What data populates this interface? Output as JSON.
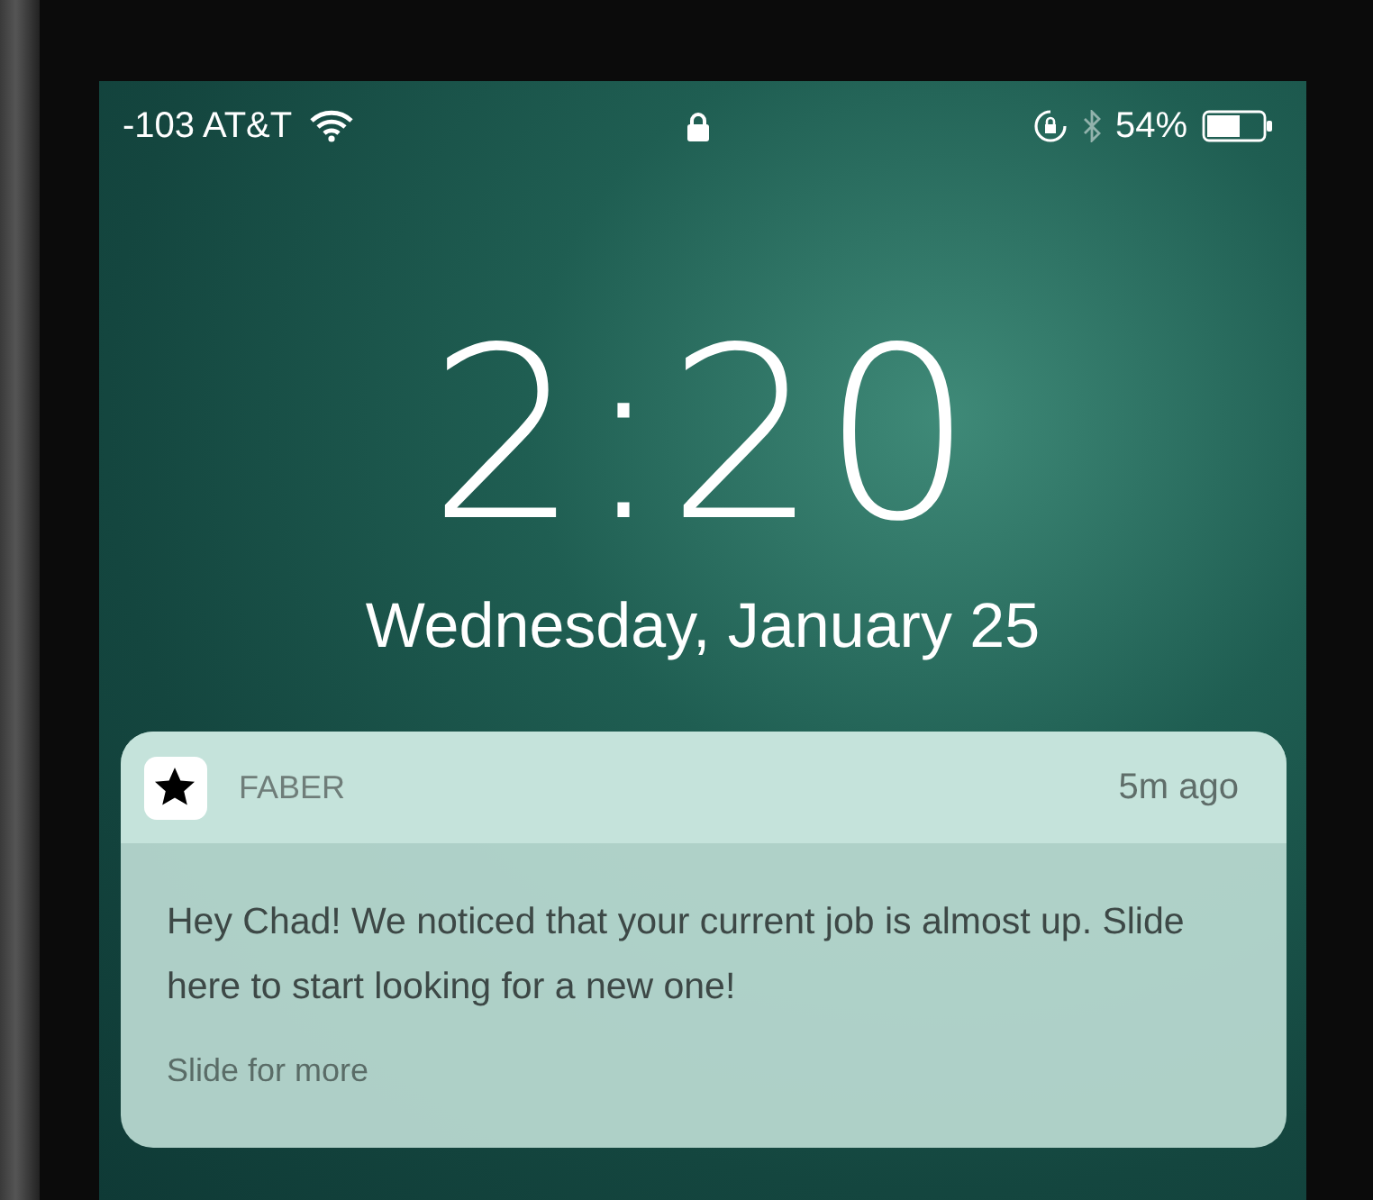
{
  "status_bar": {
    "carrier": "-103 AT&T",
    "battery": "54%"
  },
  "lock_screen": {
    "time": "2:20",
    "date": "Wednesday, January 25"
  },
  "notification": {
    "app": "FABER",
    "time": "5m ago",
    "message": "Hey Chad! We noticed that your current job is almost up. Slide here to start looking for a new one!",
    "action": "Slide for more"
  }
}
